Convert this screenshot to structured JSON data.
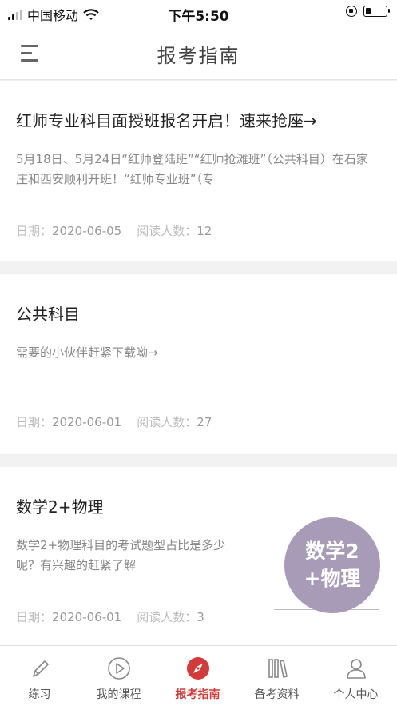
{
  "status_bar": {
    "carrier": "中国移动",
    "time": "下午5:50",
    "battery_level": 0.25
  },
  "header": {
    "title": "报考指南",
    "menu_icon": "menu-icon"
  },
  "articles": [
    {
      "title": "红师专业科目面授班报名开启！速来抢座→",
      "desc": "5月18日、5月24日“红师登陆班”“红师抢滩班”（公共科目）在石家庄和西安顺利开班！“红师专业班”（专",
      "date_label": "日期：",
      "date": "2020-06-05",
      "reads_label": "阅读人数：",
      "reads": "12"
    },
    {
      "title": "公共科目",
      "desc": "需要的小伙伴赶紧下载呦→",
      "date_label": "日期：",
      "date": "2020-06-01",
      "reads_label": "阅读人数：",
      "reads": "27"
    },
    {
      "title": "数学2+物理",
      "desc": "数学2+物理科目的考试题型占比是多少呢？有兴趣的赶紧了解",
      "date_label": "日期：",
      "date": "2020-06-01",
      "reads_label": "阅读人数：",
      "reads": "3",
      "thumb_line1": "数学2",
      "thumb_line2": "+物理",
      "thumb_color": "#a89bb8"
    }
  ],
  "tabs": [
    {
      "label": "练习",
      "icon": "pencil-icon"
    },
    {
      "label": "我的课程",
      "icon": "play-icon"
    },
    {
      "label": "报考指南",
      "icon": "compass-icon",
      "active": true
    },
    {
      "label": "备考资料",
      "icon": "books-icon"
    },
    {
      "label": "个人中心",
      "icon": "person-icon"
    }
  ],
  "colors": {
    "accent": "#d33a3a",
    "thumb": "#a89bb8"
  }
}
